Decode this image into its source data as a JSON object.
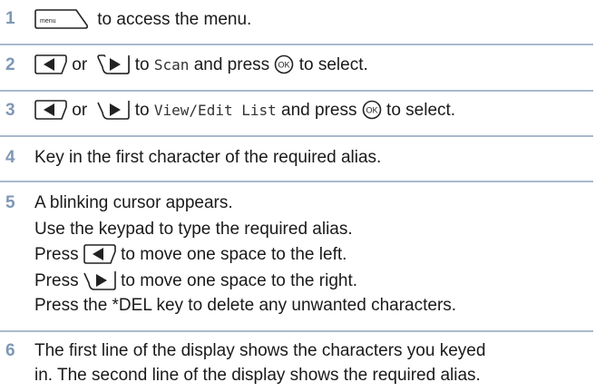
{
  "steps": [
    {
      "num": "1",
      "menu_key": "menu",
      "text": "to access the menu."
    },
    {
      "num": "2",
      "or": "or",
      "to": "to",
      "target": "Scan",
      "and_press": "and press",
      "to_select": "to select."
    },
    {
      "num": "3",
      "or": "or",
      "to": "to",
      "target": "View/Edit List",
      "and_press": "and press",
      "to_select": "to select."
    },
    {
      "num": "4",
      "text": "Key in the first character of the required alias."
    },
    {
      "num": "5",
      "line1": "A blinking cursor appears.",
      "line2": "Use the keypad to type the required alias.",
      "press": "Press",
      "line3_tail": "to move one space to the left.",
      "line4_tail": "to move one space to the right.",
      "line5": "Press the *DEL key to delete any unwanted characters."
    },
    {
      "num": "6",
      "line1": "The first line of the display shows the characters you keyed",
      "line2": "in. The second line of the display shows the required alias."
    }
  ],
  "colors": {
    "step_number": "#7f97b5",
    "rule": "#a9b9cd"
  }
}
